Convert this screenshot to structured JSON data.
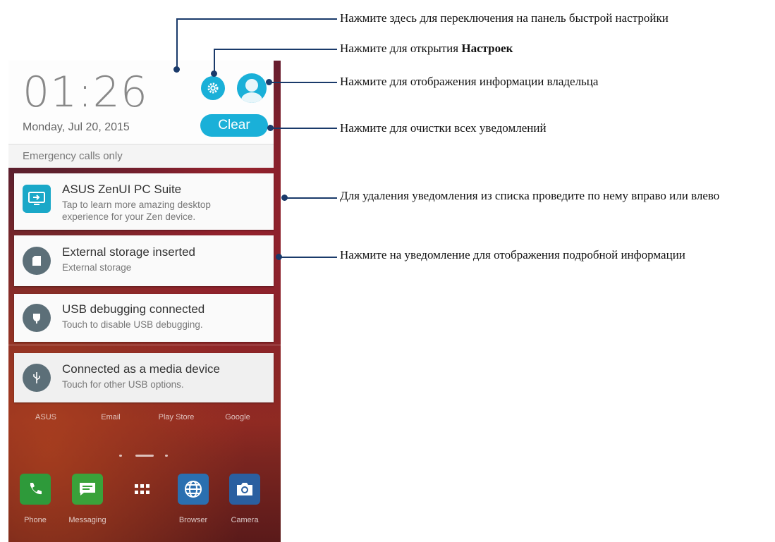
{
  "phone": {
    "clock": "01:26",
    "date": "Monday, Jul 20, 2015",
    "clear_label": "Clear",
    "emergency": "Emergency calls only",
    "notifications": [
      {
        "title": "ASUS ZenUI PC Suite",
        "subtitle": "Tap to learn more amazing desktop experience for your Zen device.",
        "icon": "pc-suite-icon"
      },
      {
        "title": "External storage inserted",
        "subtitle": "External storage",
        "icon": "sd-card-icon"
      },
      {
        "title": "USB debugging connected",
        "subtitle": "Touch to disable USB debugging.",
        "icon": "usb-debug-icon"
      },
      {
        "title": "Connected as a media device",
        "subtitle": "Touch for other USB options.",
        "icon": "usb-icon"
      }
    ],
    "apps": [
      "ASUS",
      "Email",
      "Play Store",
      "Google"
    ],
    "dock": [
      "Phone",
      "Messaging",
      "Browser",
      "Camera"
    ]
  },
  "annotations": {
    "quick_settings": "Нажмите здесь для переключения на панель быстрой настройки",
    "settings_prefix": "Нажмите для открытия ",
    "settings_bold": "Настроек",
    "owner": "Нажмите для отображения информации владельца",
    "clear": "Нажмите для очистки всех уведомлений",
    "swipe": "Для удаления уведомления из списка проведите по нему вправо или влево",
    "tap": "Нажмите на уведомление для отображения подробной информации"
  },
  "colors": {
    "accent": "#1ab0d8",
    "callout_line": "#1a3a6a",
    "notif_icon_bg": "#5c6f78"
  }
}
